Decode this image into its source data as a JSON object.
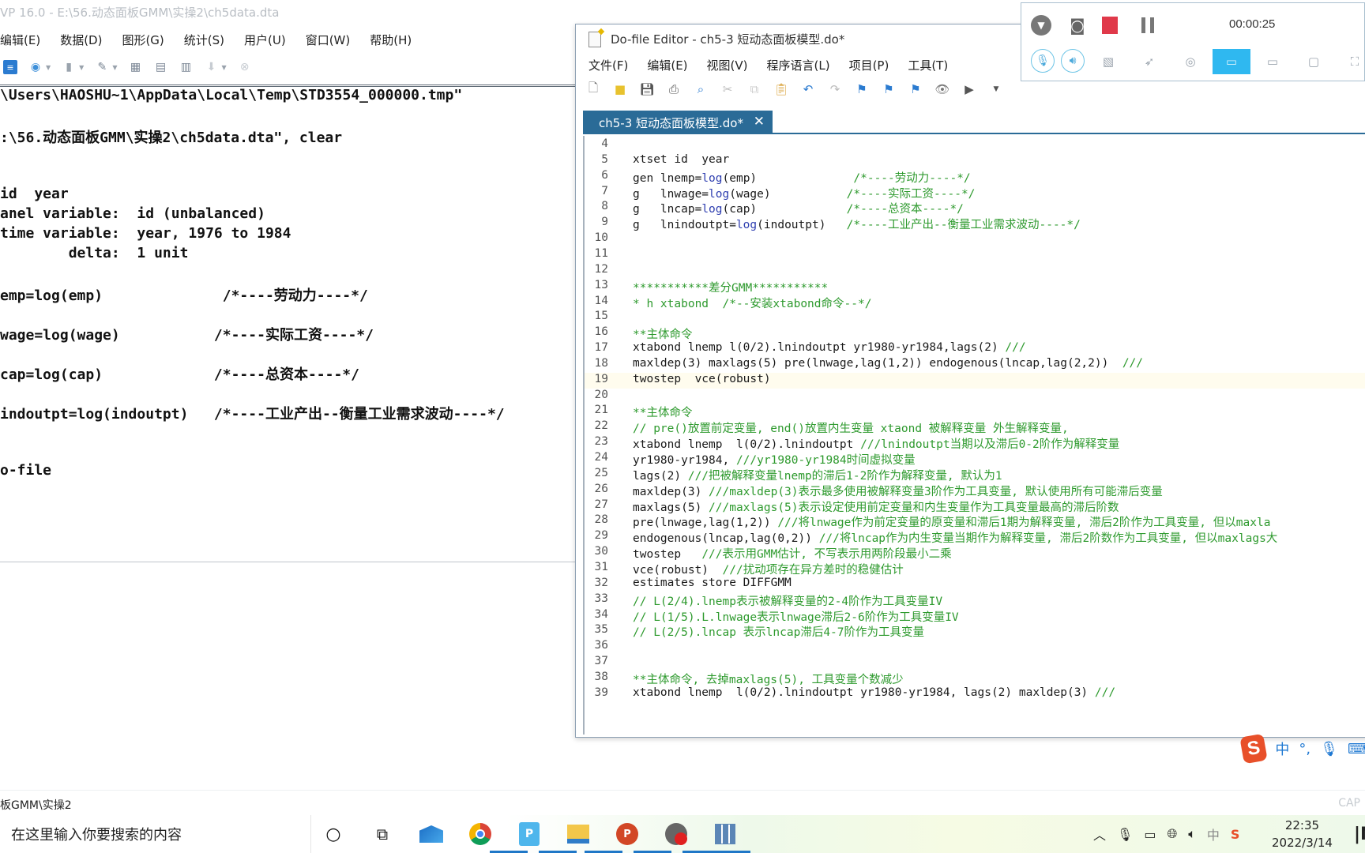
{
  "stata": {
    "title": "VP 16.0 - E:\\56.动态面板GMM\\实操2\\ch5data.dta",
    "menu": [
      "编辑(E)",
      "数据(D)",
      "图形(G)",
      "统计(S)",
      "用户(U)",
      "窗口(W)",
      "帮助(H)"
    ],
    "toolbar_icons": [
      "log-icon",
      "viewer-icon",
      "graph-icon",
      "do-file-editor-icon",
      "data-editor-icon",
      "data-browser-icon",
      "variables-manager-icon",
      "more-icon",
      "break-icon"
    ],
    "results": [
      "\\Users\\HAOSHU~1\\AppData\\Local\\Temp\\STD3554_000000.tmp\"",
      ":\\56.动态面板GMM\\实操2\\ch5data.dta\", clear",
      "id  year",
      "anel variable:  id (unbalanced)",
      "time variable:  year, 1976 to 1984",
      "        delta:  1 unit",
      "emp=log(emp)              /*----劳动力----*/",
      "wage=log(wage)           /*----实际工资----*/",
      "cap=log(cap)             /*----总资本----*/",
      "indoutpt=log(indoutpt)   /*----工业产出--衡量工业需求波动----*/",
      "o-file"
    ],
    "status_path": "板GMM\\实操2",
    "cap_label": "CAP"
  },
  "dofile": {
    "title": "Do-file Editor - ch5-3 短动态面板模型.do*",
    "menu": [
      "文件(F)",
      "编辑(E)",
      "视图(V)",
      "程序语言(L)",
      "项目(P)",
      "工具(T)"
    ],
    "tab_label": "ch5-3 短动态面板模型.do*",
    "tab_close": "✕",
    "lines": [
      {
        "n": "4",
        "code": "",
        "comment": ""
      },
      {
        "n": "5",
        "code": "xtset id  year",
        "comment": ""
      },
      {
        "n": "6",
        "code": "gen lnemp=log(emp)              ",
        "comment": "/*----劳动力----*/"
      },
      {
        "n": "7",
        "code": "g   lnwage=log(wage)           ",
        "comment": "/*----实际工资----*/"
      },
      {
        "n": "8",
        "code": "g   lncap=log(cap)             ",
        "comment": "/*----总资本----*/"
      },
      {
        "n": "9",
        "code": "g   lnindoutpt=log(indoutpt)   ",
        "comment": "/*----工业产出--衡量工业需求波动----*/"
      },
      {
        "n": "10",
        "code": "",
        "comment": ""
      },
      {
        "n": "11",
        "code": "",
        "comment": ""
      },
      {
        "n": "12",
        "code": "",
        "comment": ""
      },
      {
        "n": "13",
        "code": "",
        "comment": "***********差分GMM***********"
      },
      {
        "n": "14",
        "code": "",
        "comment": "* h xtabond  /*--安装xtabond命令--*/"
      },
      {
        "n": "15",
        "code": "",
        "comment": ""
      },
      {
        "n": "16",
        "code": "",
        "comment": "**主体命令"
      },
      {
        "n": "17",
        "code": "xtabond lnemp l(0/2).lnindoutpt yr1980-yr1984,lags(2) ",
        "comment": "///"
      },
      {
        "n": "18",
        "code": "maxldep(3) maxlags(5) pre(lnwage,lag(1,2)) endogenous(lncap,lag(2,2))  ",
        "comment": "///"
      },
      {
        "n": "19",
        "code": "twostep  vce(robust)",
        "comment": ""
      },
      {
        "n": "20",
        "code": "",
        "comment": ""
      },
      {
        "n": "21",
        "code": "",
        "comment": "**主体命令"
      },
      {
        "n": "22",
        "code": "",
        "comment": "// pre()放置前定变量, end()放置内生变量 xtaond 被解释变量 外生解释变量,"
      },
      {
        "n": "23",
        "code": "xtabond lnemp  l(0/2).lnindoutpt ",
        "comment": "///lnindoutpt当期以及滞后0-2阶作为解释变量"
      },
      {
        "n": "24",
        "code": "yr1980-yr1984, ",
        "comment": "///yr1980-yr1984时间虚拟变量"
      },
      {
        "n": "25",
        "code": "lags(2) ",
        "comment": "///把被解释变量lnemp的滞后1-2阶作为解释变量, 默认为1"
      },
      {
        "n": "26",
        "code": "maxldep(3) ",
        "comment": "///maxldep(3)表示最多使用被解释变量3阶作为工具变量, 默认使用所有可能滞后变量"
      },
      {
        "n": "27",
        "code": "maxlags(5) ",
        "comment": "///maxlags(5)表示设定使用前定变量和内生变量作为工具变量最高的滞后阶数"
      },
      {
        "n": "28",
        "code": "pre(lnwage,lag(1,2)) ",
        "comment": "///将lnwage作为前定变量的原变量和滞后1期为解释变量, 滞后2阶作为工具变量, 但以maxla"
      },
      {
        "n": "29",
        "code": "endogenous(lncap,lag(0,2)) ",
        "comment": "///将lncap作为内生变量当期作为解释变量, 滞后2阶数作为工具变量, 但以maxlags大"
      },
      {
        "n": "30",
        "code": "twostep   ",
        "comment": "///表示用GMM估计, 不写表示用两阶段最小二乘"
      },
      {
        "n": "31",
        "code": "vce(robust)  ",
        "comment": "///扰动项存在异方差时的稳健估计"
      },
      {
        "n": "32",
        "code": "estimates store DIFFGMM",
        "comment": ""
      },
      {
        "n": "33",
        "code": "",
        "comment": "// L(2/4).lnemp表示被解释变量的2-4阶作为工具变量IV"
      },
      {
        "n": "34",
        "code": "",
        "comment": "// L(1/5).L.lnwage表示lnwage滞后2-6阶作为工具变量IV"
      },
      {
        "n": "35",
        "code": "",
        "comment": "// L(2/5).lncap 表示lncap滞后4-7阶作为工具变量"
      },
      {
        "n": "36",
        "code": "",
        "comment": ""
      },
      {
        "n": "37",
        "code": "",
        "comment": ""
      },
      {
        "n": "38",
        "code": "",
        "comment": "**主体命令, 去掉maxlags(5), 工具变量个数减少"
      },
      {
        "n": "39",
        "code": "xtabond lnemp  l(0/2).lnindoutpt yr1980-yr1984, lags(2) maxldep(3) ",
        "comment": "///"
      }
    ]
  },
  "recorder": {
    "elapsed": "00:00:25",
    "record_color": "#e0394a",
    "active_mode_color": "#2fb8f0"
  },
  "ime": {
    "items": [
      "中",
      "°,",
      "mic",
      "keyboard"
    ]
  },
  "taskbar": {
    "search_placeholder": "在这里输入你要搜索的内容",
    "apps": [
      "cortana",
      "task-view",
      "mail",
      "chrome",
      "pdf-reader",
      "file-explorer",
      "powerpoint",
      "screen-recorder",
      "stata"
    ],
    "time": "22:35",
    "date": "2022/3/14",
    "tray_lang": "中"
  }
}
